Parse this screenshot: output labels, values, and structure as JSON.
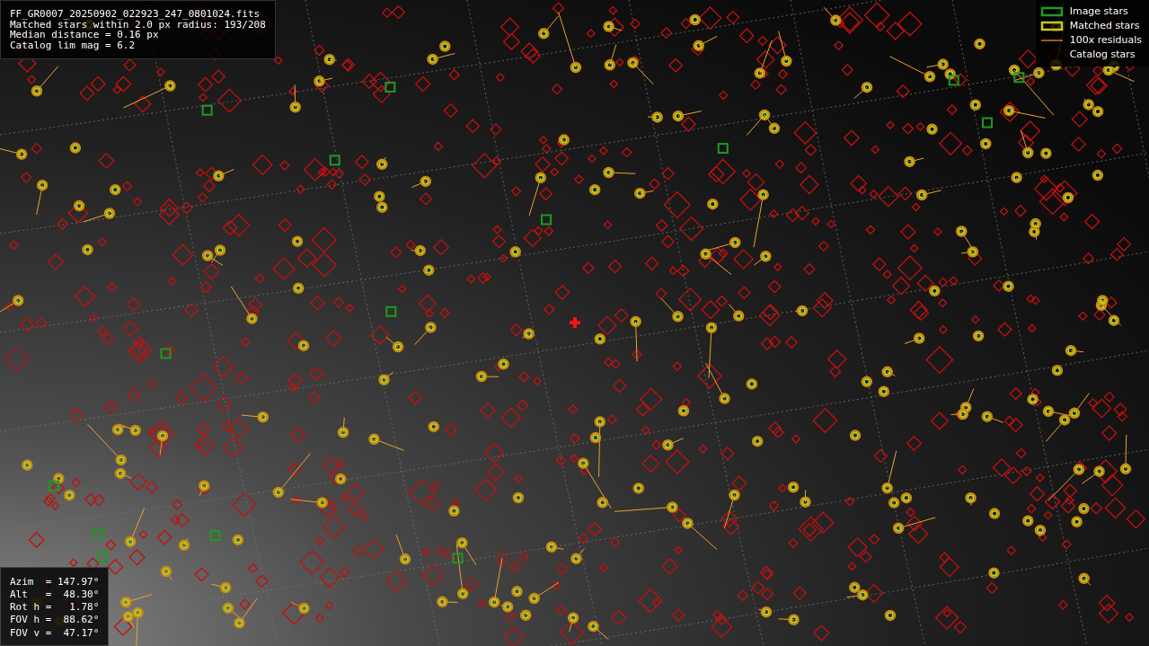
{
  "info": {
    "lines": [
      "FF_GR0007_20250902_022923_247_0801024.fits",
      "Matched stars within 2.0 px radius: 193/208",
      "Median distance = 0.16 px",
      "Catalog lim mag = 6.2"
    ]
  },
  "legend": [
    {
      "kind": "image",
      "label": "Image stars"
    },
    {
      "kind": "matched",
      "label": "Matched stars"
    },
    {
      "kind": "residual",
      "label": "100x residuals"
    },
    {
      "kind": "catalog",
      "label": "Catalog stars"
    }
  ],
  "pointing": {
    "lines": [
      "Azim  = 147.97°",
      "Alt   =  48.30°",
      "Rot h =   1.78°",
      "FOV h =  88.62°",
      "FOV v =  47.17°"
    ]
  }
}
